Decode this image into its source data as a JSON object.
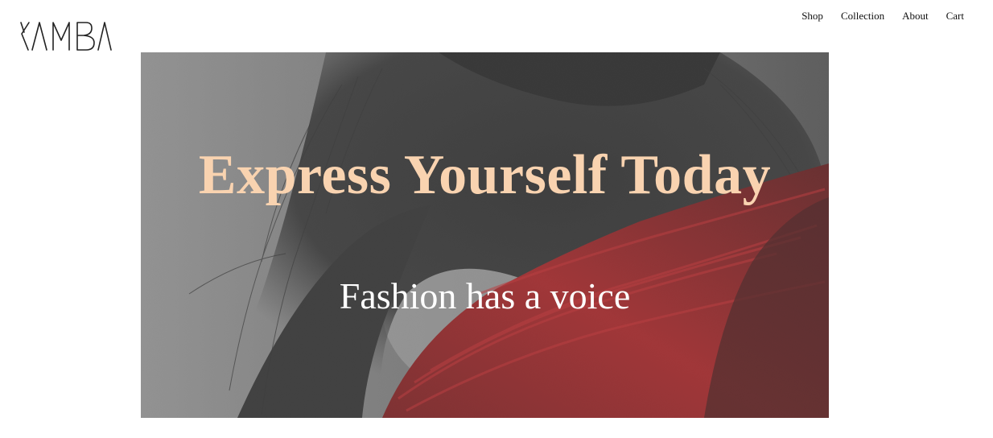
{
  "brand": {
    "logo_text": "KAMBA"
  },
  "nav": {
    "items": [
      {
        "label": "Shop"
      },
      {
        "label": "Collection"
      },
      {
        "label": "About"
      },
      {
        "label": "Cart"
      }
    ]
  },
  "hero": {
    "title": "Express Yourself Today",
    "subtitle": "Fashion has a voice",
    "colors": {
      "title": "#f9d3b0",
      "subtitle": "#ffffff",
      "paint_accent": "#b00d10"
    }
  }
}
